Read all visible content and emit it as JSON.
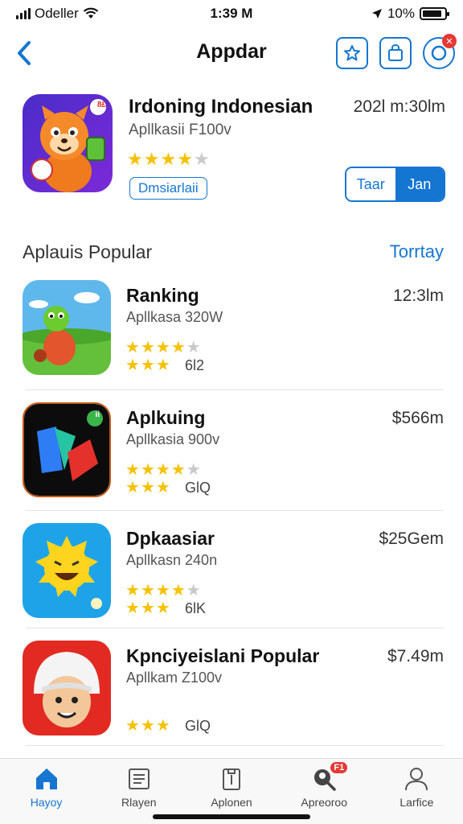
{
  "status_bar": {
    "carrier": "Odeller",
    "time": "1:39 M",
    "battery": "10%",
    "battery_level": 0.9
  },
  "nav": {
    "title": "Appdar",
    "back_icon": "chevron-left-icon",
    "actions": [
      "star-icon",
      "shopping-bag-icon",
      "camera-lens-icon"
    ],
    "notif_badge": "✕"
  },
  "featured": {
    "title": "Irdoning Indonesian",
    "subtitle": "Apllkasii F100v",
    "time": "202l m:30lm",
    "rating": 4,
    "stars": [
      "★",
      "★",
      "★",
      "★",
      "★"
    ],
    "badge": "Dmsiarlaii",
    "icon_badge": "8£",
    "segment": [
      "Taar",
      "Jan"
    ],
    "segment_active": 1
  },
  "section": {
    "title": "Aplauis Popular",
    "link": "Torrtay"
  },
  "apps": [
    {
      "title": "Ranking",
      "subtitle": "Apllkasa 320W",
      "price": "12:3lm",
      "rating": 4,
      "count": "6l2",
      "stars1": [
        "★",
        "★",
        "★",
        "★",
        "★"
      ],
      "stars2": [
        "★",
        "★",
        "★"
      ]
    },
    {
      "title": "Aplkuing",
      "subtitle": "Apllkasia 900v",
      "price": "$566m",
      "rating": 4,
      "count": "GlQ",
      "icon_badge": "ii",
      "stars1": [
        "★",
        "★",
        "★",
        "★",
        "★"
      ],
      "stars2": [
        "★",
        "★",
        "★"
      ]
    },
    {
      "title": "Dpkaasiar",
      "subtitle": "Apllkasn 240n",
      "price": "$25Gem",
      "rating": 4,
      "count": "6lK",
      "stars1": [
        "★",
        "★",
        "★",
        "★",
        "★"
      ],
      "stars2": [
        "★",
        "★",
        "★"
      ]
    },
    {
      "title": "Kpnciyeislani Popular",
      "subtitle": "Apllkam Z100v",
      "price": "$7.49m",
      "rating": 3,
      "count": "GlQ",
      "stars1": [],
      "stars2": [
        "★",
        "★",
        "★"
      ]
    }
  ],
  "tabs": [
    {
      "label": "Hayoy",
      "icon": "home-icon",
      "active": true
    },
    {
      "label": "Rlayen",
      "icon": "news-icon",
      "active": false
    },
    {
      "label": "Aplonen",
      "icon": "clipboard-icon",
      "active": false
    },
    {
      "label": "Apreoroo",
      "icon": "search-icon",
      "active": false,
      "badge": "F1"
    },
    {
      "label": "Larfice",
      "icon": "person-icon",
      "active": false
    }
  ],
  "colors": {
    "accent": "#1576d1",
    "star": "#f5c100",
    "badge": "#e53935"
  }
}
